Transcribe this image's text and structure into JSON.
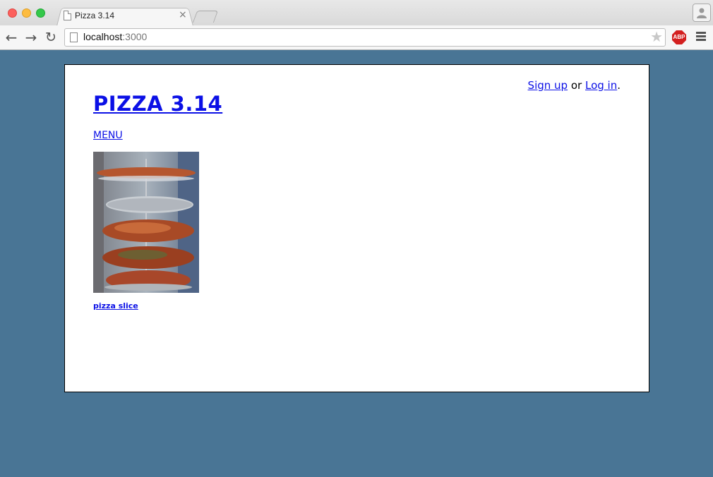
{
  "browser": {
    "tab_title": "Pizza 3.14",
    "tab_close": "×",
    "url_host": "localhost",
    "url_port": ":3000",
    "adblock_label": "ABP",
    "icons": [
      "back-arrow-icon",
      "forward-arrow-icon",
      "reload-icon",
      "star-icon",
      "profile-icon",
      "menu-icon",
      "page-icon"
    ]
  },
  "header": {
    "signup_label": "Sign up",
    "or_text": "or",
    "login_label": "Log in",
    "trailing": ".",
    "site_title": "PIZZA 3.14",
    "menu_label": "MENU"
  },
  "products": [
    {
      "name": "pizza slice",
      "image_alt": "pizza slices on a rack"
    }
  ],
  "colors": {
    "background": "#497595",
    "link": "#0b10e6"
  }
}
